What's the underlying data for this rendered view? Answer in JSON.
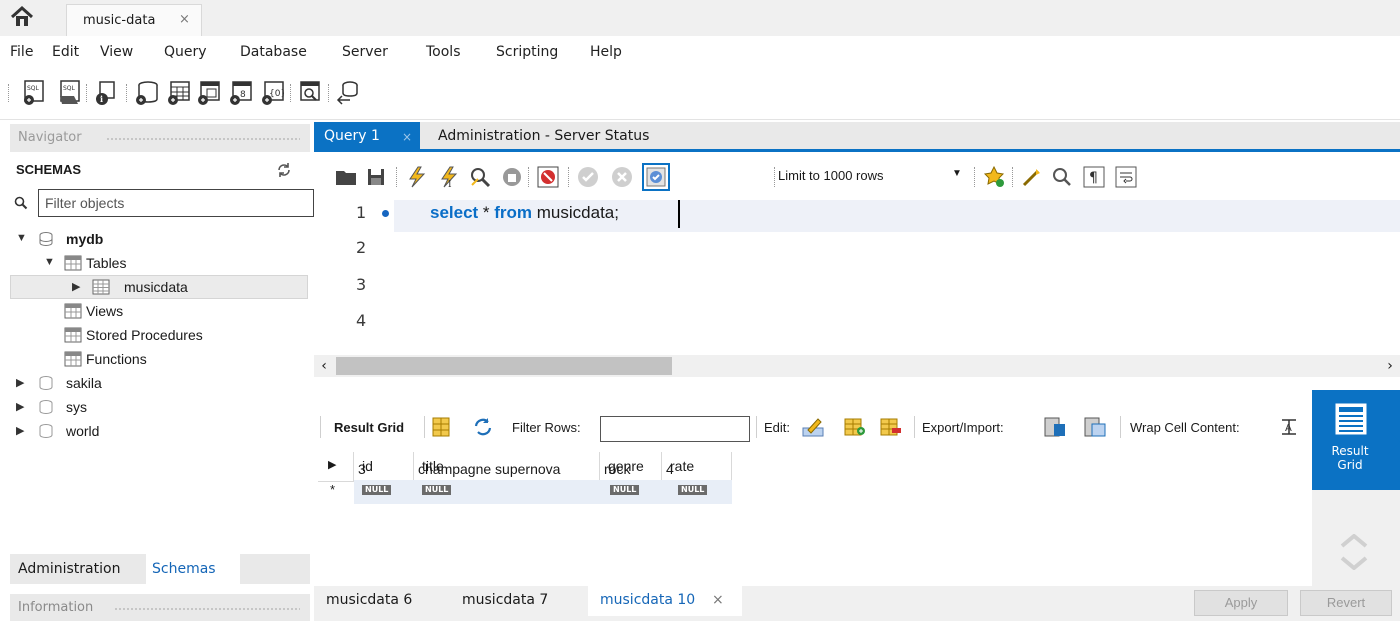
{
  "window_tab": {
    "title": "music-data",
    "close": "×"
  },
  "menu": [
    "File",
    "Edit",
    "View",
    "Query",
    "Database",
    "Server",
    "Tools",
    "Scripting",
    "Help"
  ],
  "navigator": {
    "header": "Navigator",
    "schemas_label": "SCHEMAS",
    "filter_placeholder": "Filter objects",
    "tree": {
      "mydb": "mydb",
      "tables": "Tables",
      "musicdata": "musicdata",
      "views": "Views",
      "stored_procedures": "Stored Procedures",
      "functions": "Functions",
      "sakila": "sakila",
      "sys": "sys",
      "world": "world"
    },
    "bottom_tabs": {
      "administration": "Administration",
      "schemas": "Schemas"
    },
    "information": "Information"
  },
  "query_tabs": {
    "query1": "Query 1",
    "query1_close": "×",
    "admin": "Administration - Server Status"
  },
  "editor_toolbar": {
    "limit": "Limit to 1000 rows"
  },
  "editor": {
    "line_numbers": [
      "1",
      "2",
      "3",
      "4"
    ],
    "code": {
      "kw1": "select",
      "star": " * ",
      "kw2": "from",
      "table": " musicdata;"
    }
  },
  "result_toolbar": {
    "result_grid": "Result Grid",
    "filter_rows": "Filter Rows:",
    "edit": "Edit:",
    "export_import": "Export/Import:",
    "wrap": "Wrap Cell Content:"
  },
  "grid": {
    "columns": [
      "id",
      "title",
      "genre",
      "rate"
    ],
    "rows": [
      [
        "3",
        "champagne supernova",
        "rock",
        "4"
      ]
    ],
    "null_label": "NULL"
  },
  "side_panel": {
    "result_grid_line1": "Result",
    "result_grid_line2": "Grid"
  },
  "bottom_tabs": {
    "t1": "musicdata 6",
    "t2": "musicdata 7",
    "t3": "musicdata 10",
    "t3_close": "×"
  },
  "buttons": {
    "apply": "Apply",
    "revert": "Revert"
  },
  "colors": {
    "accent": "#0b72c4",
    "keyword": "#0a6ec7",
    "link": "#1566b7"
  }
}
